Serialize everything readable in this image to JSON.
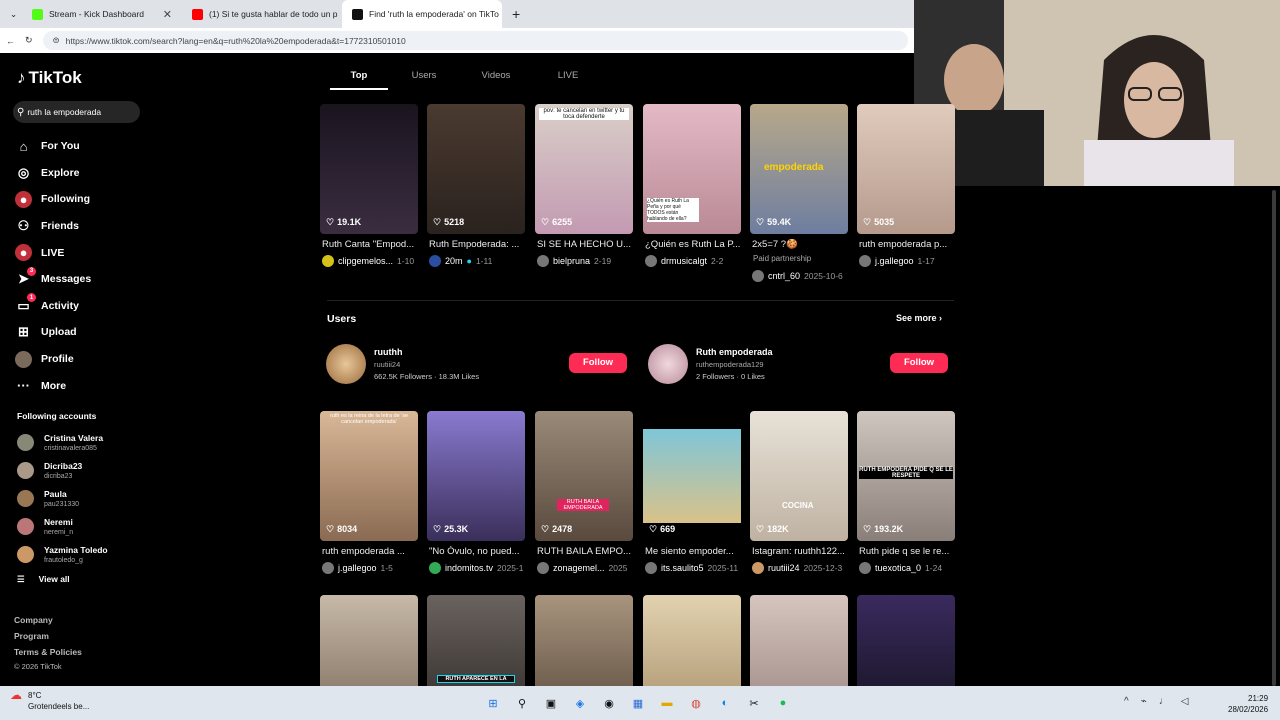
{
  "browser": {
    "tabs": [
      {
        "label": "Stream - Kick Dashboard",
        "color": "#53fc18"
      },
      {
        "label": "(1) Si te gusta hablar de todo un p",
        "color": "#ff0000"
      },
      {
        "label": "Find 'ruth la empoderada' on TikTo",
        "color": "#111111"
      }
    ],
    "new_tab": "+",
    "url": "https://www.tiktok.com/search?lang=en&q=ruth%20la%20empoderada&t=1772310501010"
  },
  "sidebar": {
    "logo": "TikTok",
    "search_value": "ruth la empoderada",
    "nav": [
      {
        "label": "For You",
        "icon": "home-icon"
      },
      {
        "label": "Explore",
        "icon": "compass-icon"
      },
      {
        "label": "Following",
        "icon": "following-icon"
      },
      {
        "label": "Friends",
        "icon": "friends-icon"
      },
      {
        "label": "LIVE",
        "icon": "live-icon"
      },
      {
        "label": "Messages",
        "icon": "message-icon",
        "badge": "3"
      },
      {
        "label": "Activity",
        "icon": "activity-icon",
        "badge": "1"
      },
      {
        "label": "Upload",
        "icon": "upload-icon"
      },
      {
        "label": "Profile",
        "icon": "avatar-icon"
      },
      {
        "label": "More",
        "icon": "more-icon"
      }
    ],
    "following_title": "Following accounts",
    "accounts": [
      {
        "name": "Cristina Valera",
        "handle": "cristinavalera085"
      },
      {
        "name": "Dicriba23",
        "handle": "dicriba23"
      },
      {
        "name": "Paula",
        "handle": "pau231330"
      },
      {
        "name": "Neremi",
        "handle": "neremi_n"
      },
      {
        "name": "Yazmina Toledo",
        "handle": "frautoledo_g"
      }
    ],
    "view_all": "View all",
    "footer": [
      "Company",
      "Program",
      "Terms & Policies",
      "© 2026 TikTok"
    ]
  },
  "filters": [
    "Top",
    "Users",
    "Videos",
    "LIVE"
  ],
  "row1": [
    {
      "likes": "19.1K",
      "caption": "Ruth Canta \"Empod...",
      "user": "clipgemelos...",
      "date": "1-10",
      "color": "#2a1e2e"
    },
    {
      "likes": "5218",
      "caption": "Ruth Empoderada: ...",
      "user": "20m",
      "date": "1-11",
      "color": "#3b2f28"
    },
    {
      "likes": "6255",
      "caption": "SI SE HA HECHO U...",
      "user": "bielpruna",
      "date": "2-19",
      "color": "#b39aa8",
      "overlay": "pov: te cancelan en twitter y tu toca defenderte"
    },
    {
      "likes": "",
      "caption": "¿Quién es Ruth La P...",
      "user": "drmusicalgt",
      "date": "2-2",
      "color": "#d8a7b5",
      "overlay": "¿Quién es Ruth La Peña y por qué TODOS están hablando de ella?"
    },
    {
      "likes": "59.4K",
      "caption": "2x5=7 ?🍪",
      "user": "cntrl_60",
      "date": "2025-10-6",
      "paid": "Paid partnership",
      "color": "#9c8a6e",
      "overlay": "empoderada"
    },
    {
      "likes": "5035",
      "caption": "ruth empoderada p...",
      "user": "j.gallegoo",
      "date": "1-17",
      "color": "#c9b3a5"
    }
  ],
  "users_section": {
    "title": "Users",
    "see_more": "See more",
    "users": [
      {
        "name": "ruuthh",
        "handle": "ruutiii24",
        "followers": "662.5K",
        "followers_label": "Followers",
        "likes": "18.3M",
        "likes_label": "Likes",
        "follow": "Follow"
      },
      {
        "name": "Ruth empoderada",
        "handle": "ruthempoderada129",
        "followers": "2",
        "followers_label": "Followers",
        "likes": "0",
        "likes_label": "Likes",
        "follow": "Follow"
      }
    ]
  },
  "row2": [
    {
      "likes": "8034",
      "caption": "ruth empoderada ...",
      "user": "j.gallegoo",
      "date": "1-5",
      "color": "#c8a98c",
      "overlay": "ruth es la reina de la letra de 'se cancelan empoderada'"
    },
    {
      "likes": "25.3K",
      "caption": "\"No Óvulo, no pued...",
      "user": "indomitos.tv",
      "date": "2025-1",
      "color": "#6b5aa8"
    },
    {
      "likes": "2478",
      "caption": "RUTH BAILA EMPO...",
      "user": "zonagemel...",
      "date": "2025",
      "color": "#8a7664",
      "overlay": "RUTH BAILA EMPODERADA"
    },
    {
      "likes": "669",
      "caption": "Me siento empoder...",
      "user": "its.saulito5",
      "date": "2025-11",
      "color": "#6fb8c9"
    },
    {
      "likes": "182K",
      "caption": "Istagram: ruuthh122...",
      "user": "ruutiii24",
      "date": "2025-12-3",
      "color": "#d8cfc2",
      "overlay": "COCINA"
    },
    {
      "likes": "193.2K",
      "caption": "Ruth pide q se le re...",
      "user": "tuexotica_0",
      "date": "1-24",
      "color": "#b4a8a2",
      "overlay": "RUTH EMPODERA PIDE Q SE LE RESPETE"
    }
  ],
  "row3": [
    {
      "color": "#a89a88"
    },
    {
      "color": "#4a4340",
      "overlay": "RUTH APARECE EN LA"
    },
    {
      "color": "#7a6a5c"
    },
    {
      "color": "#c7b59b"
    },
    {
      "color": "#b8a6a0"
    },
    {
      "color": "#22202e"
    }
  ],
  "taskbar": {
    "temp": "8°C",
    "weather": "Grotendeels be...",
    "time": "21:29",
    "date": "28/02/2026"
  }
}
